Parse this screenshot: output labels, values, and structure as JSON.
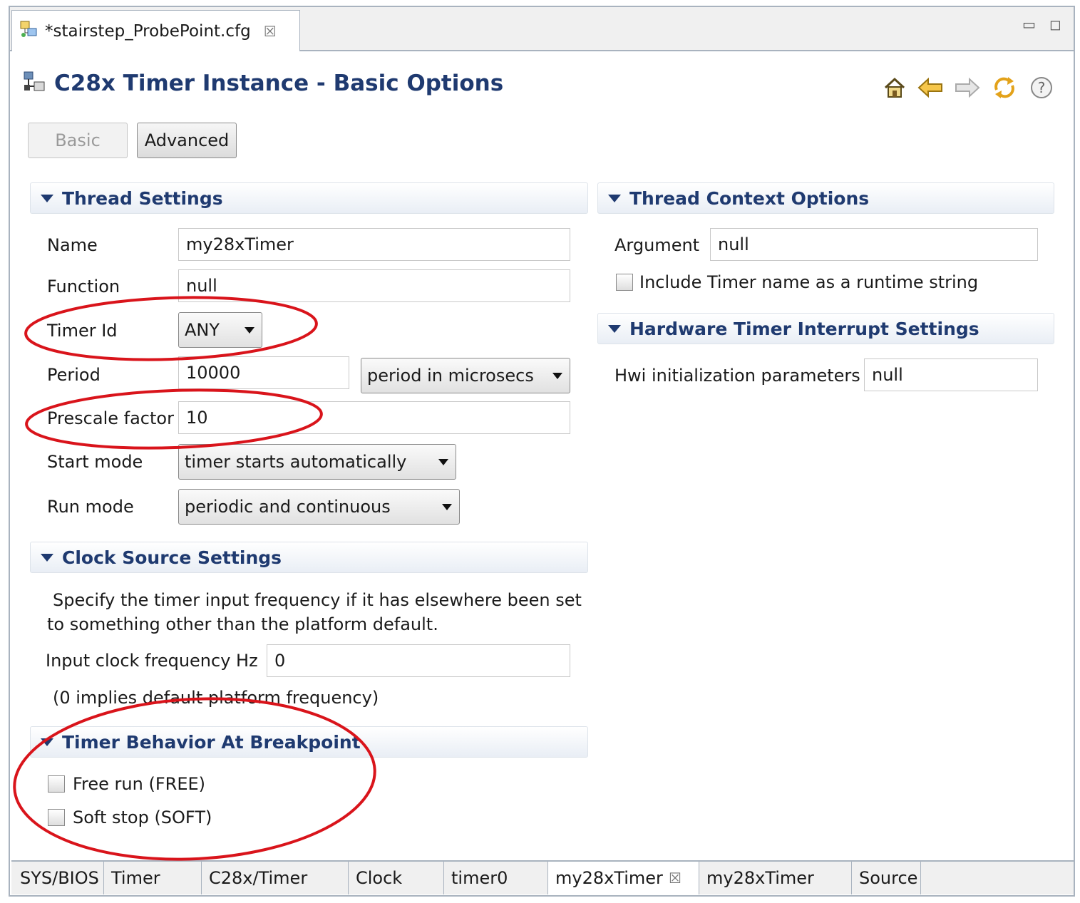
{
  "editor_tab": {
    "label": "*stairstep_ProbePoint.cfg",
    "close": "☒"
  },
  "window_controls": {
    "minimize": "▭",
    "maximize": "◻"
  },
  "header": {
    "title": "C28x Timer Instance - Basic Options"
  },
  "mode_buttons": {
    "basic": "Basic",
    "advanced": "Advanced"
  },
  "thread_settings": {
    "title": "Thread Settings",
    "name_label": "Name",
    "name_value": "my28xTimer",
    "function_label": "Function",
    "function_value": "null",
    "timer_id_label": "Timer Id",
    "timer_id_value": "ANY",
    "period_label": "Period",
    "period_value": "10000",
    "period_unit": "period in microsecs",
    "prescale_label": "Prescale factor",
    "prescale_value": "10",
    "start_mode_label": "Start mode",
    "start_mode_value": "timer starts automatically",
    "run_mode_label": "Run mode",
    "run_mode_value": "periodic and continuous"
  },
  "thread_context": {
    "title": "Thread Context Options",
    "argument_label": "Argument",
    "argument_value": "null",
    "include_name_label": "Include Timer name as a runtime string"
  },
  "hwi_settings": {
    "title": "Hardware Timer Interrupt Settings",
    "hwi_label": "Hwi initialization parameters",
    "hwi_value": "null"
  },
  "clock_source": {
    "title": "Clock Source Settings",
    "desc_line1": "Specify the timer input frequency if it has elsewhere been set",
    "desc_line2": "to something other than the platform default.",
    "freq_label": "Input clock frequency Hz",
    "freq_value": "0",
    "note": "(0 implies default platform frequency)"
  },
  "breakpoint": {
    "title": "Timer Behavior At Breakpoint",
    "free_run_label": "Free run (FREE)",
    "soft_stop_label": "Soft stop (SOFT)"
  },
  "bottom_tabs": [
    {
      "label": "SYS/BIOS"
    },
    {
      "label": "Timer"
    },
    {
      "label": "C28x/Timer"
    },
    {
      "label": "Clock"
    },
    {
      "label": "timer0"
    },
    {
      "label": "my28xTimer",
      "close": "☒",
      "active": true
    },
    {
      "label": "my28xTimer"
    },
    {
      "label": "Source"
    }
  ],
  "colors": {
    "title": "#1f3a70",
    "annotation": "#d9141b",
    "frame": "#a9b3bf"
  }
}
